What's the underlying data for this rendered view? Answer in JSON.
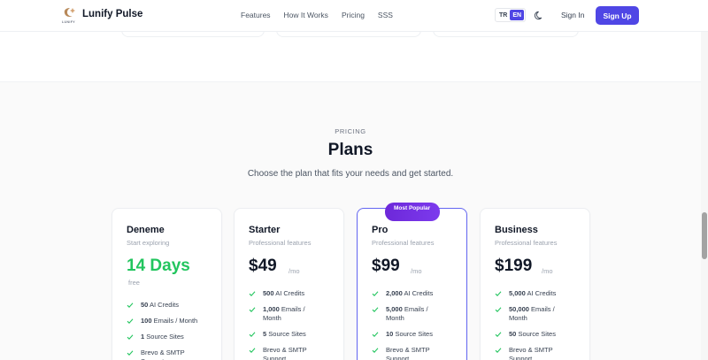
{
  "header": {
    "brand": "Lunify Pulse",
    "logo_sub": "LUNIFY",
    "nav": [
      "Features",
      "How It Works",
      "Pricing",
      "SSS"
    ],
    "lang": [
      "TR",
      "EN"
    ],
    "active_lang": "EN",
    "sign_in": "Sign In",
    "sign_up": "Sign Up"
  },
  "pricing": {
    "eyebrow": "PRICING",
    "title": "Plans",
    "subtitle": "Choose the plan that fits your needs and get started.",
    "plans": [
      {
        "name": "Deneme",
        "desc": "Start exploring",
        "price": "14 Days",
        "price_note": "free",
        "features": [
          {
            "bold": "50",
            "text": "AI Credits"
          },
          {
            "bold": "100",
            "text": "Emails / Month"
          },
          {
            "bold": "1",
            "text": "Source Sites"
          },
          {
            "bold": "",
            "text": "Brevo & SMTP Support"
          }
        ]
      },
      {
        "name": "Starter",
        "desc": "Professional features",
        "price": "$49",
        "per": "/mo",
        "features": [
          {
            "bold": "500",
            "text": "AI Credits"
          },
          {
            "bold": "1,000",
            "text": "Emails / Month"
          },
          {
            "bold": "5",
            "text": "Source Sites"
          },
          {
            "bold": "",
            "text": "Brevo & SMTP Support"
          }
        ]
      },
      {
        "name": "Pro",
        "desc": "Professional features",
        "badge": "Most Popular",
        "price": "$99",
        "per": "/mo",
        "features": [
          {
            "bold": "2,000",
            "text": "AI Credits"
          },
          {
            "bold": "5,000",
            "text": "Emails / Month"
          },
          {
            "bold": "10",
            "text": "Source Sites"
          },
          {
            "bold": "",
            "text": "Brevo & SMTP Support"
          }
        ]
      },
      {
        "name": "Business",
        "desc": "Professional features",
        "price": "$199",
        "per": "/mo",
        "features": [
          {
            "bold": "5,000",
            "text": "AI Credits"
          },
          {
            "bold": "50,000",
            "text": "Emails / Month"
          },
          {
            "bold": "50",
            "text": "Source Sites"
          },
          {
            "bold": "",
            "text": "Brevo & SMTP Support"
          }
        ]
      }
    ]
  },
  "colors": {
    "accent": "#4f46e5",
    "badge": "#6d28d9",
    "trial_price": "#22c55e",
    "check": "#22c55e"
  }
}
